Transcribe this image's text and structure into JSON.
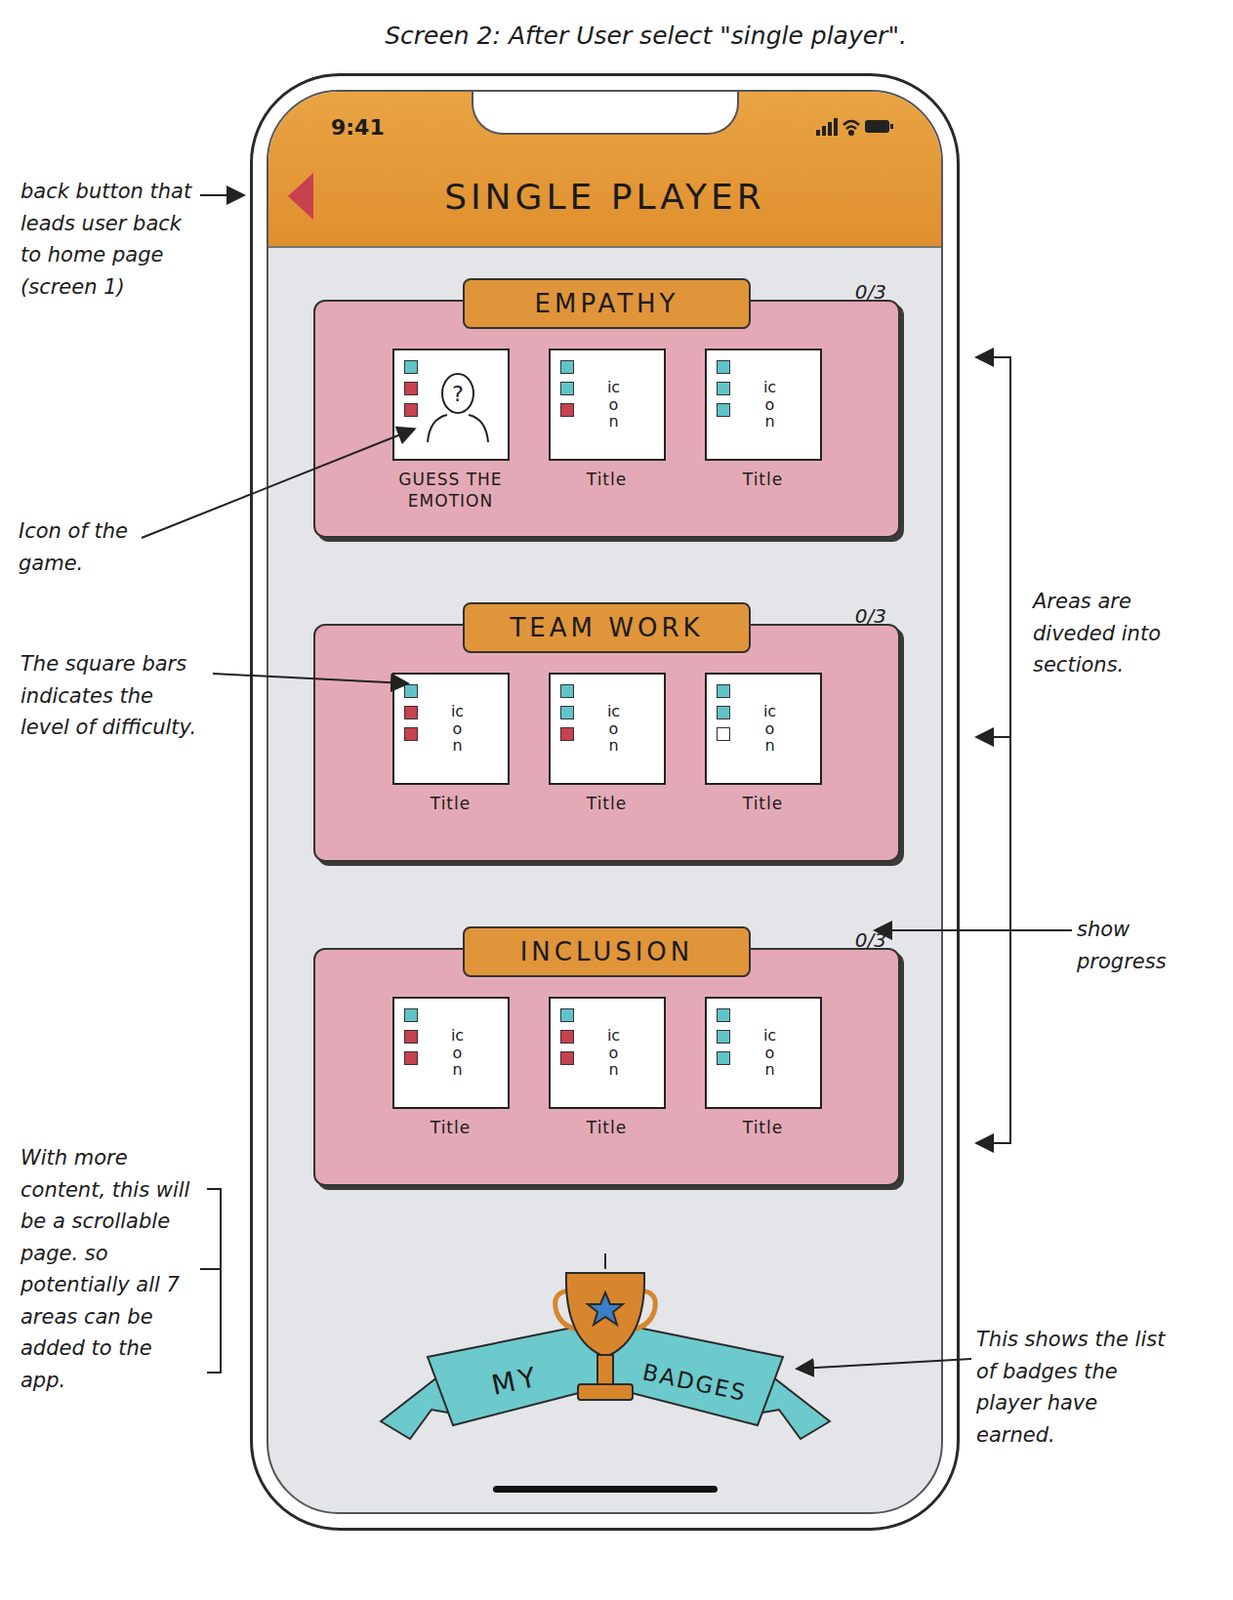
{
  "page_title": "Screen 2: After User select \"single player\".",
  "status_bar": {
    "time": "9:41"
  },
  "header": {
    "title": "SINGLE PLAYER"
  },
  "sections": [
    {
      "title": "EMPATHY",
      "progress": "0/3",
      "games": [
        {
          "kind": "avatar",
          "icon": "?",
          "title": "GUESS THE EMOTION",
          "difficulty": [
            "#5fc4c8",
            "#c8414f",
            "#c8414f"
          ]
        },
        {
          "kind": "placeholder",
          "icon": "icon",
          "title": "Title",
          "difficulty": [
            "#5fc4c8",
            "#5fc4c8",
            "#c8414f"
          ]
        },
        {
          "kind": "placeholder",
          "icon": "icon",
          "title": "Title",
          "difficulty": [
            "#5fc4c8",
            "#5fc4c8",
            "#5fc4c8"
          ]
        }
      ]
    },
    {
      "title": "TEAM WORK",
      "progress": "0/3",
      "games": [
        {
          "kind": "placeholder",
          "icon": "icon",
          "title": "Title",
          "difficulty": [
            "#5fc4c8",
            "#c8414f",
            "#c8414f"
          ]
        },
        {
          "kind": "placeholder",
          "icon": "icon",
          "title": "Title",
          "difficulty": [
            "#5fc4c8",
            "#5fc4c8",
            "#c8414f"
          ]
        },
        {
          "kind": "placeholder",
          "icon": "icon",
          "title": "Title",
          "difficulty": [
            "#5fc4c8",
            "#5fc4c8",
            "#ffffff"
          ]
        }
      ]
    },
    {
      "title": "INCLUSION",
      "progress": "0/3",
      "games": [
        {
          "kind": "placeholder",
          "icon": "icon",
          "title": "Title",
          "difficulty": [
            "#5fc4c8",
            "#c8414f",
            "#c8414f"
          ]
        },
        {
          "kind": "placeholder",
          "icon": "icon",
          "title": "Title",
          "difficulty": [
            "#5fc4c8",
            "#c8414f",
            "#c8414f"
          ]
        },
        {
          "kind": "placeholder",
          "icon": "icon",
          "title": "Title",
          "difficulty": [
            "#5fc4c8",
            "#5fc4c8",
            "#5fc4c8"
          ]
        }
      ]
    }
  ],
  "badges": {
    "left": "MY",
    "right": "BADGES"
  },
  "annotations": {
    "back_button": "back button that leads user back to home page (screen 1)",
    "game_icon": "Icon of the game.",
    "difficulty": "The square bars indicates the level of difficulty.",
    "sections": "Areas are diveded into sections.",
    "progress": "show progress",
    "scroll": "With more content, this will be a scrollable page. so potentially all 7 areas can be added to the app.",
    "badges": "This shows the list of badges the player have earned."
  }
}
